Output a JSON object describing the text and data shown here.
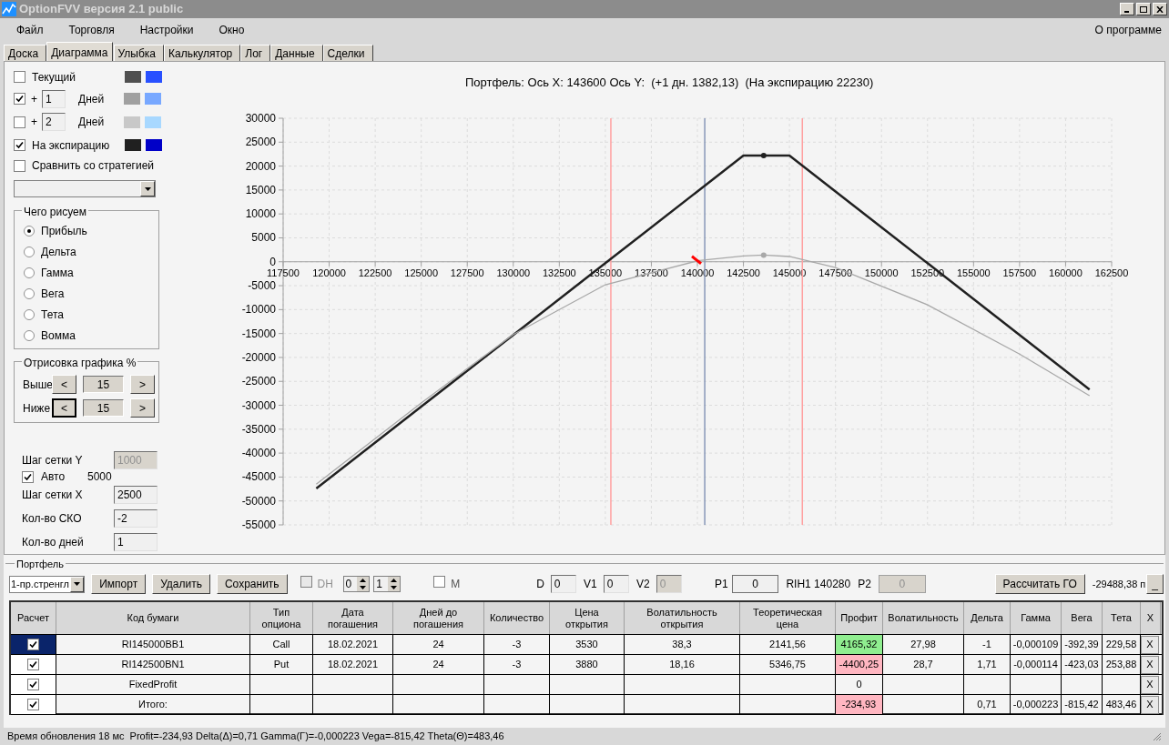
{
  "window": {
    "title": "OptionFVV версия 2.1 public"
  },
  "menu": {
    "items": [
      "Файл",
      "Торговля",
      "Настройки",
      "Окно"
    ],
    "about": "О программе"
  },
  "tabs": [
    {
      "label": "Доска",
      "selected": false
    },
    {
      "label": "Диаграмма",
      "selected": true
    },
    {
      "label": "Улыбка",
      "selected": false
    },
    {
      "label": "Калькулятор",
      "selected": false
    },
    {
      "label": "Лог",
      "selected": false
    },
    {
      "label": "Данные",
      "selected": false
    },
    {
      "label": "Сделки",
      "selected": false
    }
  ],
  "curves": [
    {
      "kind": "named",
      "label": "Текущий",
      "checked": false,
      "swatches": [
        {
          "color": "#505050"
        },
        {
          "color": "#2850ff"
        }
      ]
    },
    {
      "kind": "days",
      "prefix": "+",
      "value": "1",
      "unit": "Дней",
      "checked": true,
      "swatches": [
        {
          "color": "#a0a0a0"
        },
        {
          "color": "#78a8ff"
        }
      ]
    },
    {
      "kind": "days",
      "prefix": "+",
      "value": "2",
      "unit": "Дней",
      "checked": false,
      "swatches": [
        {
          "color": "#c8c8c8"
        },
        {
          "color": "#a8d8ff"
        }
      ]
    },
    {
      "kind": "named",
      "label": "На экспирацию",
      "checked": true,
      "swatches": [
        {
          "color": "#202020"
        },
        {
          "color": "#0000c8"
        }
      ]
    }
  ],
  "compare": {
    "label": "Сравнить со стратегией",
    "checked": false
  },
  "plot_group": {
    "title": "Чего рисуем",
    "options": [
      {
        "label": "Прибыль",
        "selected": true
      },
      {
        "label": "Дельта",
        "selected": false
      },
      {
        "label": "Гамма",
        "selected": false
      },
      {
        "label": "Вега",
        "selected": false
      },
      {
        "label": "Тета",
        "selected": false
      },
      {
        "label": "Вомма",
        "selected": false
      }
    ]
  },
  "range_group": {
    "title": "Отрисовка графика %",
    "rows": [
      {
        "label": "Выше",
        "value": "15",
        "left": "<",
        "right": ">",
        "focused": false
      },
      {
        "label": "Ниже",
        "value": "15",
        "left": "<",
        "right": ">",
        "focused": true
      }
    ]
  },
  "grid": {
    "y_label": "Шаг сетки Y",
    "y_value": "1000",
    "auto": {
      "label": "Авто",
      "checked": true
    },
    "auto_value": "5000",
    "x_label": "Шаг сетки X",
    "x_value": "2500",
    "sko_label": "Кол-во СКО",
    "sko_value": "-2",
    "days_label": "Кол-во дней",
    "days_value": "1"
  },
  "chart": {
    "title": "Портфель: Ось X: 143600 Ось Y:  (+1 дн. 1382,13)  (На экспирацию 22230)",
    "chart_data": {
      "type": "line",
      "x": [
        119300,
        125000,
        130000,
        135000,
        140000,
        142500,
        143600,
        145000,
        147500,
        152500,
        157500,
        161300
      ],
      "series": [
        {
          "color": "#202020",
          "values": [
            -47400,
            -30300,
            -15300,
            -300,
            14700,
            22200,
            22200,
            22200,
            14700,
            -300,
            -15300,
            -26700
          ]
        },
        {
          "color": "#a8a8a8",
          "values": [
            -46500,
            -29500,
            -15200,
            -4800,
            200,
            1200,
            1400,
            1100,
            -1200,
            -9000,
            -19300,
            -28000
          ]
        }
      ],
      "grid": true,
      "xlim": [
        117500,
        162500
      ],
      "ylim": [
        -55000,
        30000
      ],
      "xticks": [
        117500,
        120000,
        122500,
        125000,
        127500,
        130000,
        132500,
        135000,
        137500,
        140000,
        142500,
        145000,
        147500,
        150000,
        152500,
        155000,
        157500,
        160000,
        162500
      ],
      "yticks": [
        -55000,
        -50000,
        -45000,
        -40000,
        -35000,
        -30000,
        -25000,
        -20000,
        -15000,
        -10000,
        -5000,
        0,
        5000,
        10000,
        15000,
        20000,
        25000,
        30000
      ],
      "ref_lines": [
        {
          "axis": "x",
          "value": 135300,
          "color": "#ffa0a0"
        },
        {
          "axis": "x",
          "value": 140400,
          "color": "#8898b8"
        },
        {
          "axis": "x",
          "value": 145700,
          "color": "#ffa0a0"
        }
      ]
    }
  },
  "portfolio": {
    "title": "Портфель",
    "strategy": "1-пр.стренгл",
    "buttons": [
      "Импорт",
      "Удалить",
      "Сохранить"
    ],
    "dh": {
      "label": "DH",
      "checked": false
    },
    "spin1": "0",
    "spin2": "1",
    "m": {
      "label": "M",
      "checked": false
    },
    "fields": [
      {
        "label": "D",
        "value": "0",
        "disabled": false
      },
      {
        "label": "V1",
        "value": "0",
        "disabled": false
      },
      {
        "label": "V2",
        "value": "0",
        "disabled": true
      }
    ],
    "p1": {
      "label": "P1",
      "value": "0"
    },
    "ticker": "RIH1 140280",
    "p2": {
      "label": "P2",
      "value": "0"
    },
    "calc_button": "Рассчитать ГО",
    "result": "-29488,38 п",
    "min_button": "_"
  },
  "table": {
    "columns": [
      "Расчет",
      "Код бумаги",
      "Тип\nопциона",
      "Дата\nпогашения",
      "Дней до\nпогашения",
      "Количество",
      "Цена\nоткрытия",
      "Волатильность\nоткрытия",
      "Теоретическая\nцена",
      "Профит",
      "Волатильность",
      "Дельта",
      "Гамма",
      "Вега",
      "Тета",
      "X"
    ],
    "rows": [
      {
        "checked": true,
        "selected": true,
        "color": "#90ee90",
        "cells": [
          "",
          "RI145000BB1",
          "Call",
          "18.02.2021",
          "24",
          "-3",
          "3530",
          "38,3",
          "2141,56",
          "4165,32",
          "27,98",
          "-1",
          "-0,000109",
          "-392,39",
          "229,58",
          "X"
        ]
      },
      {
        "checked": true,
        "selected": false,
        "color": "#ffb6c1",
        "cells": [
          "",
          "RI142500BN1",
          "Put",
          "18.02.2021",
          "24",
          "-3",
          "3880",
          "18,16",
          "5346,75",
          "-4400,25",
          "28,7",
          "1,71",
          "-0,000114",
          "-423,03",
          "253,88",
          "X"
        ]
      },
      {
        "checked": true,
        "selected": false,
        "cells": [
          "",
          "FixedProfit",
          "",
          "",
          "",
          "",
          "",
          "",
          "",
          "0",
          "",
          "",
          "",
          "",
          "",
          "X"
        ]
      },
      {
        "checked": true,
        "selected": false,
        "color": "#ffb6c1",
        "cells": [
          "",
          "Итого:",
          "",
          "",
          "",
          "",
          "",
          "",
          "",
          "-234,93",
          "",
          "0,71",
          "-0,000223",
          "-815,42",
          "483,46",
          "X"
        ]
      }
    ]
  },
  "status_bar": "Время обновления 18 мс  Profit=-234,93 Delta(Δ)=0,71 Gamma(Γ)=-0,000223 Vega=-815,42 Theta(Θ)=483,46"
}
